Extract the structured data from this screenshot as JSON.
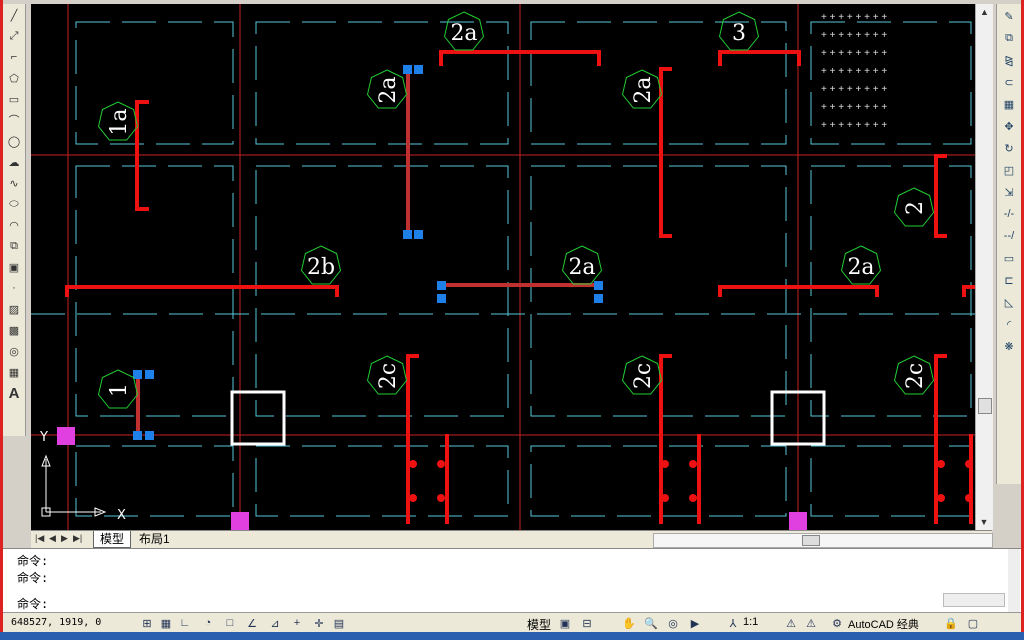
{
  "tabs": {
    "model": "模型",
    "layout": "布局1"
  },
  "command": {
    "line1": "命令:",
    "line2": "命令:",
    "prompt": "命令:"
  },
  "status": {
    "coordinates": "648527, 1919, 0",
    "model_label": "模型",
    "scale": "1:1",
    "workspace": "AutoCAD 经典"
  },
  "ucs": {
    "x": "X",
    "y": "Y"
  },
  "tags": {
    "t1": "2a",
    "t2": "3",
    "t3": "2a",
    "t4": "2a",
    "t5": "1a",
    "t6": "2",
    "t7": "2b",
    "t8": "2a",
    "t9": "2a",
    "t10": "1",
    "t11": "2c",
    "t12": "2c",
    "t13": "2c"
  },
  "colors": {
    "canvas": "#000000",
    "grid_red": "#cc2222",
    "grid_cyan": "#56c8d8",
    "wall_red": "#ee1111",
    "tag_green": "#22cc33",
    "grip_blue": "#1e80e8",
    "grip_magenta": "#e040e0"
  },
  "icons": {
    "left_toolbar": [
      "line-icon",
      "construction-line-icon",
      "polyline-icon",
      "polygon-icon",
      "rectangle-icon",
      "arc-icon",
      "circle-icon",
      "revision-cloud-icon",
      "spline-icon",
      "ellipse-icon",
      "ellipse-arc-icon",
      "insert-block-icon",
      "make-block-icon",
      "point-icon",
      "hatch-icon",
      "gradient-icon",
      "region-icon",
      "table-icon",
      "text-icon"
    ],
    "right_toolbar": [
      "erase-icon",
      "copy-icon",
      "mirror-icon",
      "offset-icon",
      "array-icon",
      "move-icon",
      "rotate-icon",
      "scale-icon",
      "stretch-icon",
      "trim-icon",
      "extend-icon",
      "break-icon",
      "join-icon",
      "chamfer-icon",
      "fillet-icon",
      "explode-icon"
    ]
  }
}
